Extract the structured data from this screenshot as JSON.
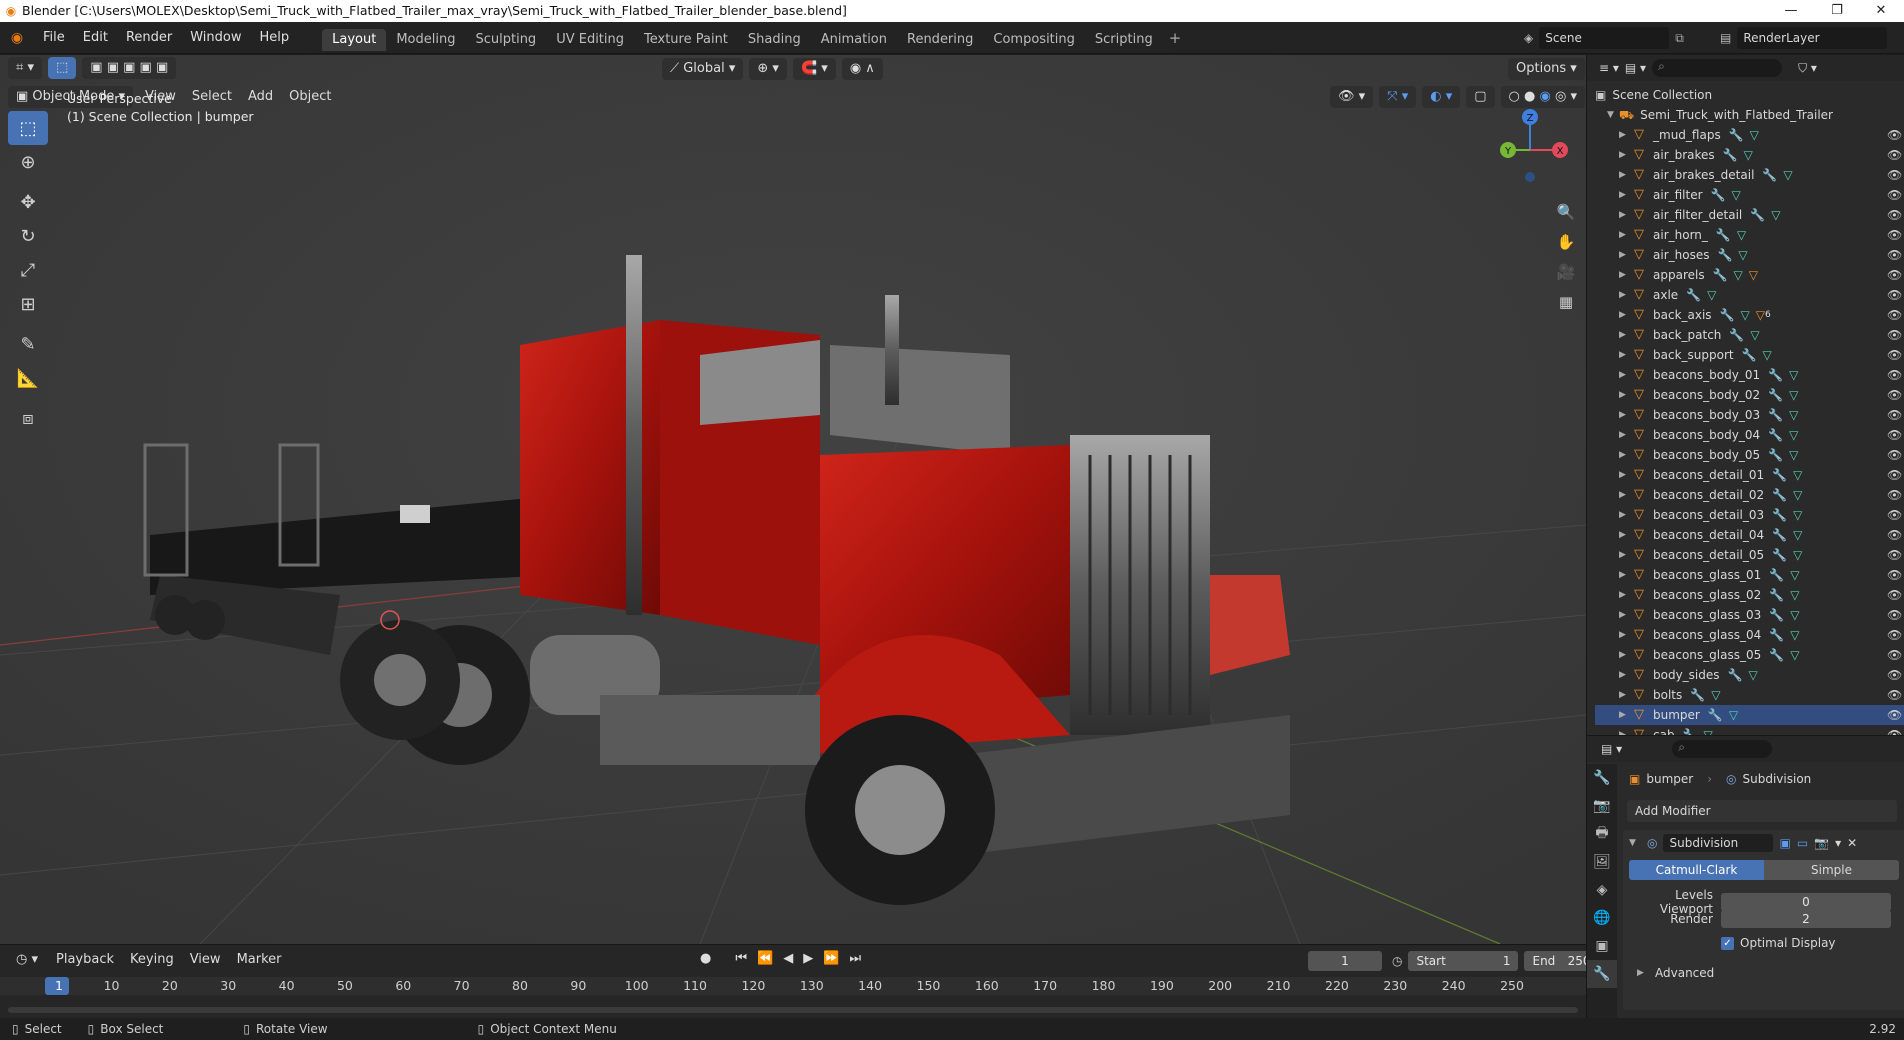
{
  "window": {
    "title": "Blender [C:\\Users\\MOLEX\\Desktop\\Semi_Truck_with_Flatbed_Trailer_max_vray\\Semi_Truck_with_Flatbed_Trailer_blender_base.blend]"
  },
  "menu": [
    "File",
    "Edit",
    "Render",
    "Window",
    "Help"
  ],
  "workspaces": [
    "Layout",
    "Modeling",
    "Sculpting",
    "UV Editing",
    "Texture Paint",
    "Shading",
    "Animation",
    "Rendering",
    "Compositing",
    "Scripting"
  ],
  "scene": {
    "name": "Scene",
    "render_layer": "RenderLayer"
  },
  "viewport": {
    "mode": "Object Mode",
    "header_menus": [
      "View",
      "Select",
      "Add",
      "Object"
    ],
    "transform_orientation": "Global",
    "options_label": "Options",
    "perspective_label": "User Perspective",
    "collection_label": "(1) Scene Collection | bumper",
    "gizmo": {
      "z": "Z",
      "y": "Y",
      "x": "X"
    }
  },
  "timeline": {
    "menus": [
      "Playback",
      "Keying",
      "View",
      "Marker"
    ],
    "current_frame": "1",
    "start_label": "Start",
    "start": "1",
    "end_label": "End",
    "end": "250",
    "ruler": [
      "1",
      "10",
      "20",
      "30",
      "40",
      "50",
      "60",
      "70",
      "80",
      "90",
      "100",
      "110",
      "120",
      "130",
      "140",
      "150",
      "160",
      "170",
      "180",
      "190",
      "200",
      "210",
      "220",
      "230",
      "240",
      "250"
    ]
  },
  "status": {
    "select": "Select",
    "box_select": "Box Select",
    "rotate_view": "Rotate View",
    "context_menu": "Object Context Menu",
    "version": "2.92"
  },
  "outliner": {
    "root": "Scene Collection",
    "collection": "Semi_Truck_with_Flatbed_Trailer",
    "selected": "bumper",
    "items": [
      "_mud_flaps",
      "air_brakes",
      "air_brakes_detail",
      "air_filter",
      "air_filter_detail",
      "air_horn_",
      "air_hoses",
      "apparels",
      "axle",
      "back_axis",
      "back_patch",
      "back_support",
      "beacons_body_01",
      "beacons_body_02",
      "beacons_body_03",
      "beacons_body_04",
      "beacons_body_05",
      "beacons_detail_01",
      "beacons_detail_02",
      "beacons_detail_03",
      "beacons_detail_04",
      "beacons_detail_05",
      "beacons_glass_01",
      "beacons_glass_02",
      "beacons_glass_03",
      "beacons_glass_04",
      "beacons_glass_05",
      "body_sides",
      "bolts",
      "bumper",
      "cab"
    ],
    "badge_back_axis": "6"
  },
  "properties": {
    "object": "bumper",
    "modifier_crumb": "Subdivision",
    "add_modifier": "Add Modifier",
    "modifier_name": "Subdivision",
    "catmull": "Catmull-Clark",
    "simple": "Simple",
    "levels_label": "Levels Viewport",
    "levels_value": "0",
    "render_label": "Render",
    "render_value": "2",
    "optimal_display": "Optimal Display",
    "advanced": "Advanced"
  },
  "colors": {
    "accent": "#4772b3",
    "object_orange": "#e9902b",
    "cab_red": "#b4140f",
    "viewport_bg": "#3c3c3c"
  }
}
